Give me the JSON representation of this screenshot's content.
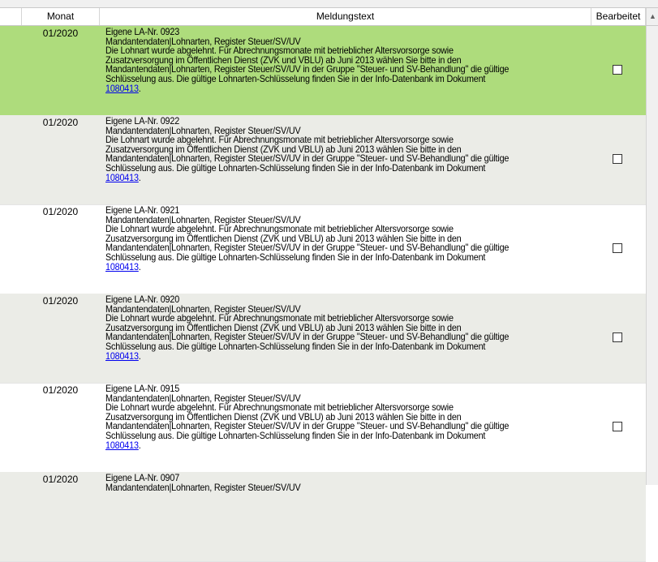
{
  "columns": {
    "monat": "Monat",
    "text": "Meldungstext",
    "bearbeitet": "Bearbeitet"
  },
  "colors": {
    "selected_row": "#aedc7c",
    "alt_row": "#ebece7",
    "link": "#0000ee"
  },
  "rows": [
    {
      "monat": "01/2020",
      "title": "Eigene LA-Nr. 0923",
      "line2": "Mandantendaten|Lohnarten, Register Steuer/SV/UV",
      "line3": "Die Lohnart wurde abgelehnt. Für Abrechnungsmonate mit betrieblicher Altersvorsorge sowie",
      "line4": "Zusatzversorgung im Öffentlichen Dienst (ZVK und VBLU) ab Juni 2013 wählen Sie bitte in den",
      "line5": "Mandantendaten|Lohnarten, Register Steuer/SV/UV in der Gruppe \"Steuer- und SV-Behandlung\" die gültige",
      "line6": "Schlüsselung aus. Die gültige Lohnarten-Schlüsselung finden Sie in der Info-Datenbank im Dokument",
      "link": "1080413",
      "suffix": ".",
      "bearbeitet": false
    },
    {
      "monat": "01/2020",
      "title": "Eigene LA-Nr. 0922",
      "line2": "Mandantendaten|Lohnarten, Register Steuer/SV/UV",
      "line3": "Die Lohnart wurde abgelehnt. Für Abrechnungsmonate mit betrieblicher Altersvorsorge sowie",
      "line4": "Zusatzversorgung im Öffentlichen Dienst (ZVK und VBLU) ab Juni 2013 wählen Sie bitte in den",
      "line5": "Mandantendaten|Lohnarten, Register Steuer/SV/UV in der Gruppe \"Steuer- und SV-Behandlung\" die gültige",
      "line6": "Schlüsselung aus. Die gültige Lohnarten-Schlüsselung finden Sie in der Info-Datenbank im Dokument",
      "link": "1080413",
      "suffix": ".",
      "bearbeitet": false
    },
    {
      "monat": "01/2020",
      "title": "Eigene LA-Nr. 0921",
      "line2": "Mandantendaten|Lohnarten, Register Steuer/SV/UV",
      "line3": "Die Lohnart wurde abgelehnt. Für Abrechnungsmonate mit betrieblicher Altersvorsorge sowie",
      "line4": "Zusatzversorgung im Öffentlichen Dienst (ZVK und VBLU) ab Juni 2013 wählen Sie bitte in den",
      "line5": "Mandantendaten|Lohnarten, Register Steuer/SV/UV in der Gruppe \"Steuer- und SV-Behandlung\" die gültige",
      "line6": "Schlüsselung aus. Die gültige Lohnarten-Schlüsselung finden Sie in der Info-Datenbank im Dokument",
      "link": "1080413",
      "suffix": ".",
      "bearbeitet": false
    },
    {
      "monat": "01/2020",
      "title": "Eigene LA-Nr. 0920",
      "line2": "Mandantendaten|Lohnarten, Register Steuer/SV/UV",
      "line3": "Die Lohnart wurde abgelehnt. Für Abrechnungsmonate mit betrieblicher Altersvorsorge sowie",
      "line4": "Zusatzversorgung im Öffentlichen Dienst (ZVK und VBLU) ab Juni 2013 wählen Sie bitte in den",
      "line5": "Mandantendaten|Lohnarten, Register Steuer/SV/UV in der Gruppe \"Steuer- und SV-Behandlung\" die gültige",
      "line6": "Schlüsselung aus. Die gültige Lohnarten-Schlüsselung finden Sie in der Info-Datenbank im Dokument",
      "link": "1080413",
      "suffix": ".",
      "bearbeitet": false
    },
    {
      "monat": "01/2020",
      "title": "Eigene LA-Nr. 0915",
      "line2": "Mandantendaten|Lohnarten, Register Steuer/SV/UV",
      "line3": "Die Lohnart wurde abgelehnt. Für Abrechnungsmonate mit betrieblicher Altersvorsorge sowie",
      "line4": "Zusatzversorgung im Öffentlichen Dienst (ZVK und VBLU) ab Juni 2013 wählen Sie bitte in den",
      "line5": "Mandantendaten|Lohnarten, Register Steuer/SV/UV in der Gruppe \"Steuer- und SV-Behandlung\" die gültige",
      "line6": "Schlüsselung aus. Die gültige Lohnarten-Schlüsselung finden Sie in der Info-Datenbank im Dokument",
      "link": "1080413",
      "suffix": ".",
      "bearbeitet": false
    },
    {
      "monat": "01/2020",
      "title": "Eigene LA-Nr. 0907",
      "line2": "Mandantendaten|Lohnarten, Register Steuer/SV/UV"
    }
  ]
}
